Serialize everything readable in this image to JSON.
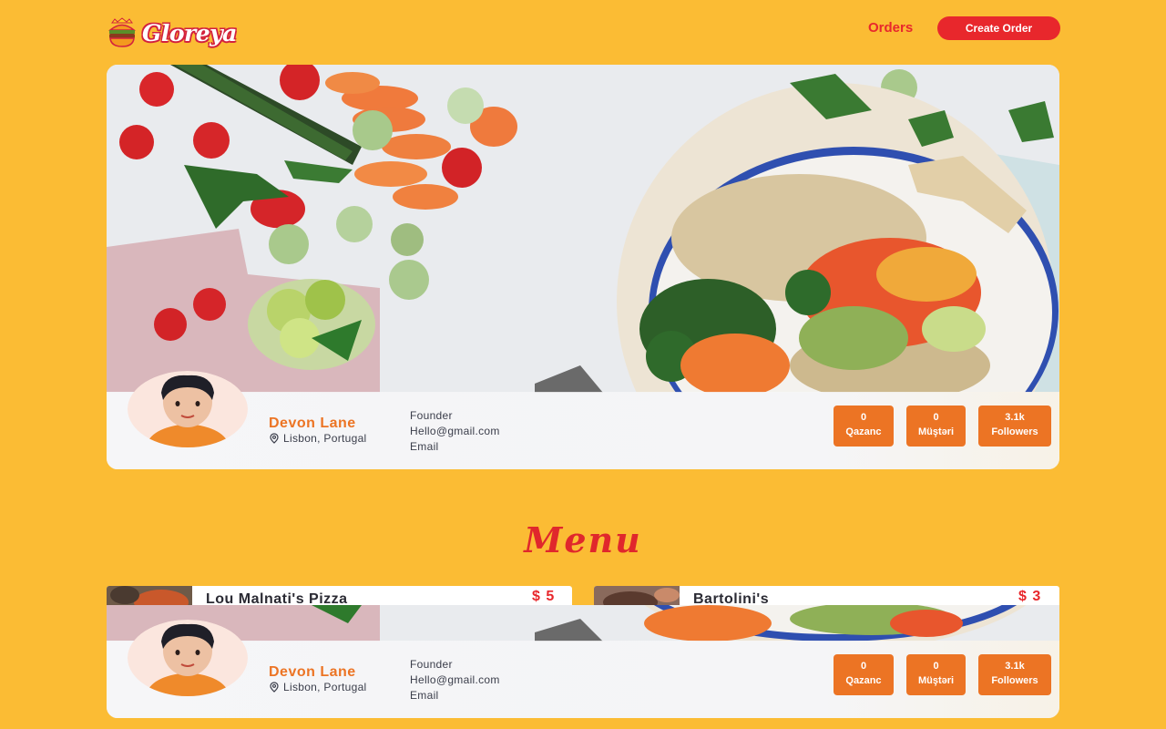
{
  "header": {
    "brand": "Gloreya",
    "nav_orders": "Orders",
    "create_order": "Create Order"
  },
  "profile": {
    "name": "Devon Lane",
    "location": "Lisbon, Portugal",
    "role": "Founder",
    "email": "Hello@gmail.com",
    "email_label": "Email",
    "stats": [
      {
        "value": "0",
        "label": "Qazanc"
      },
      {
        "value": "0",
        "label": "Müştəri"
      },
      {
        "value": "3.1k",
        "label": "Followers"
      }
    ]
  },
  "menu": {
    "title": "Menu",
    "items": [
      {
        "name": "Lou Malnati's Pizza",
        "price": "$ 5"
      },
      {
        "name": "Bartolini's",
        "price": "$ 3"
      }
    ]
  },
  "colors": {
    "background": "#FBBC34",
    "accent_red": "#E8272C",
    "accent_orange": "#EC7424"
  }
}
